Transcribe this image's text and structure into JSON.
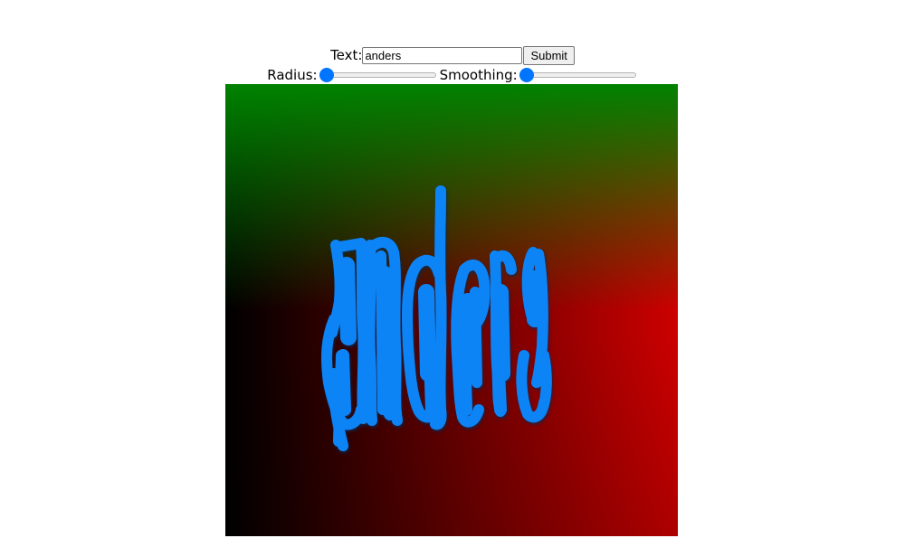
{
  "form": {
    "text_label": "Text:",
    "text_value": "anders",
    "submit_label": "Submit"
  },
  "sliders": {
    "radius_label": "Radius:",
    "radius_value": 0,
    "smoothing_label": "Smoothing:",
    "smoothing_value": 0
  },
  "canvas": {
    "rendered_text": "anders",
    "text_color": "#0a84f5",
    "gradient_colors": {
      "top_left": "#007800",
      "top_right": "#c07800",
      "bottom_left": "#000000",
      "bottom_right": "#cc0000"
    }
  }
}
